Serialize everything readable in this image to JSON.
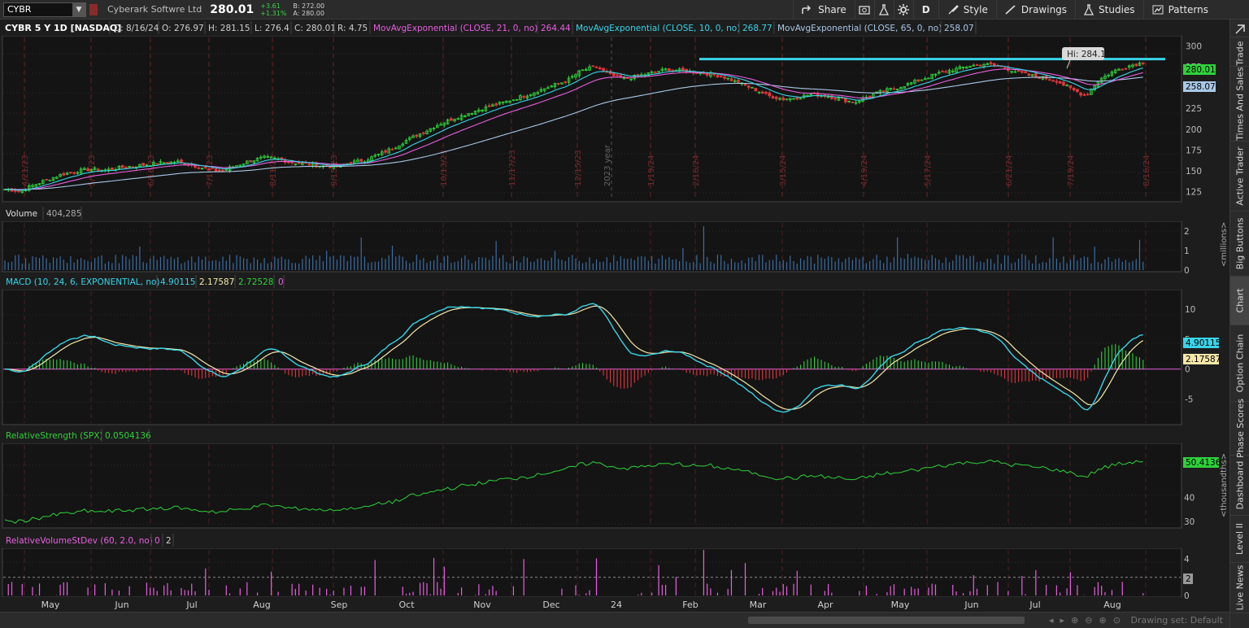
{
  "toolbar": {
    "symbol": "CYBR",
    "company": "Cyberark Softwre Ltd",
    "last": "280.01",
    "change": "+3.61",
    "change_pct": "+1.31%",
    "bid": "B: 272.00",
    "ask": "A: 280.00",
    "share": "Share",
    "period": "D",
    "style": "Style",
    "drawings": "Drawings",
    "studies": "Studies",
    "patterns": "Patterns"
  },
  "header": {
    "title": "CYBR 5 Y 1D [NASDAQ]",
    "date": "D: 8/16/24",
    "open": "O: 276.97",
    "high": "H: 281.15",
    "low": "L: 276.4",
    "close": "C: 280.01",
    "range": "R: 4.75",
    "ma21_label": "MovAvgExponential (CLOSE, 21, 0, no)",
    "ma21_value": "264.44",
    "ma10_label": "MovAvgExponential (CLOSE, 10, 0, no)",
    "ma10_value": "268.77",
    "ma65_label": "MovAvgExponential (CLOSE, 65, 0, no)",
    "ma65_value": "258.07"
  },
  "price_panel": {
    "hi_label": "Hi: 284.1",
    "price_tag": "280.01",
    "ma_tag": "258.07",
    "year_marker": "2023 year",
    "axis_ticks": [
      "300",
      "275",
      "250",
      "225",
      "200",
      "175",
      "150",
      "125"
    ],
    "date_labels": [
      "4/21/23",
      "5/19/23",
      "6/16/23",
      "7/14/23",
      "8/11/23",
      "9/15/23",
      "10/13/23",
      "11/17/23",
      "12/15/23",
      "1/19/24",
      "2/16/24",
      "3/15/24",
      "4/19/24",
      "5/17/24",
      "6/21/24",
      "7/19/24",
      "8/16/24"
    ]
  },
  "volume_panel": {
    "label": "Volume",
    "value": "404,285",
    "axis_ticks": [
      "2",
      "1",
      "0"
    ],
    "unit": "<millions>"
  },
  "macd_panel": {
    "label": "MACD (10, 24, 6, EXPONENTIAL, no)",
    "value": "4.90115",
    "avg": "2.17587",
    "diff": "2.72528",
    "zero": "0",
    "value_tag": "4.90115",
    "avg_tag": "2.17587",
    "axis_ticks": [
      "10",
      "5",
      "0",
      "-5"
    ]
  },
  "rs_panel": {
    "label": "RelativeStrength (SPX)",
    "value": "0.0504136",
    "tag": "50.4136",
    "axis_ticks": [
      "40",
      "30"
    ],
    "unit": "<thousandths>"
  },
  "rv_panel": {
    "label": "RelativeVolumeStDev (60, 2.0, no)",
    "v1": "0",
    "v2": "2",
    "tag": "2",
    "axis_ticks": [
      "4",
      "2",
      "0"
    ]
  },
  "x_axis": {
    "months": [
      "May",
      "Jun",
      "Jul",
      "Aug",
      "Sep",
      "Oct",
      "Nov",
      "Dec",
      "24",
      "Feb",
      "Mar",
      "Apr",
      "May",
      "Jun",
      "Jul",
      "Aug"
    ]
  },
  "sidebar": {
    "tabs": [
      "Trade",
      "Times And Sales",
      "Active Trader",
      "Big Buttons",
      "Chart",
      "Option Chain",
      "Phase Scores",
      "Dashboard",
      "Level II",
      "Live News"
    ]
  },
  "status": {
    "drawing_set": "Drawing set: Default"
  },
  "colors": {
    "up": "#2fd13a",
    "down": "#e2363c",
    "ma10": "#39d4e8",
    "ma21": "#e85fe0",
    "ma65": "#a9c8e8",
    "hi_line": "#39d4e8",
    "rs_line": "#2fd13a",
    "rv_bar": "#e85fe0",
    "grid_red": "#6a2323"
  },
  "chart_data": {
    "type": "candlestick",
    "symbol": "CYBR",
    "ylim": [
      115,
      310
    ],
    "months": [
      "May",
      "Jun",
      "Jul",
      "Aug",
      "Sep",
      "Oct",
      "Nov",
      "Dec",
      "24",
      "Feb",
      "Mar",
      "Apr",
      "May",
      "Jun",
      "Jul",
      "Aug"
    ],
    "close_path": [
      128,
      126,
      133,
      140,
      146,
      150,
      152,
      151,
      154,
      156,
      158,
      160,
      161,
      157,
      152,
      150,
      156,
      162,
      166,
      164,
      160,
      158,
      156,
      155,
      160,
      163,
      170,
      178,
      188,
      196,
      205,
      212,
      218,
      224,
      229,
      234,
      240,
      246,
      252,
      258,
      270,
      275,
      265,
      260,
      264,
      268,
      272,
      270,
      268,
      266,
      262,
      255,
      248,
      240,
      236,
      238,
      242,
      240,
      236,
      232,
      240,
      246,
      250,
      256,
      262,
      268,
      272,
      276,
      278,
      276,
      270,
      265,
      262,
      258,
      248,
      240,
      260,
      270,
      276,
      280
    ],
    "hi_line": 284.1,
    "macd": {
      "ylim": [
        -9,
        13
      ],
      "zero": 0
    },
    "rs": {
      "ylim": [
        28,
        62
      ]
    },
    "rv": {
      "ylim": [
        0,
        5
      ],
      "threshold": 2
    }
  }
}
